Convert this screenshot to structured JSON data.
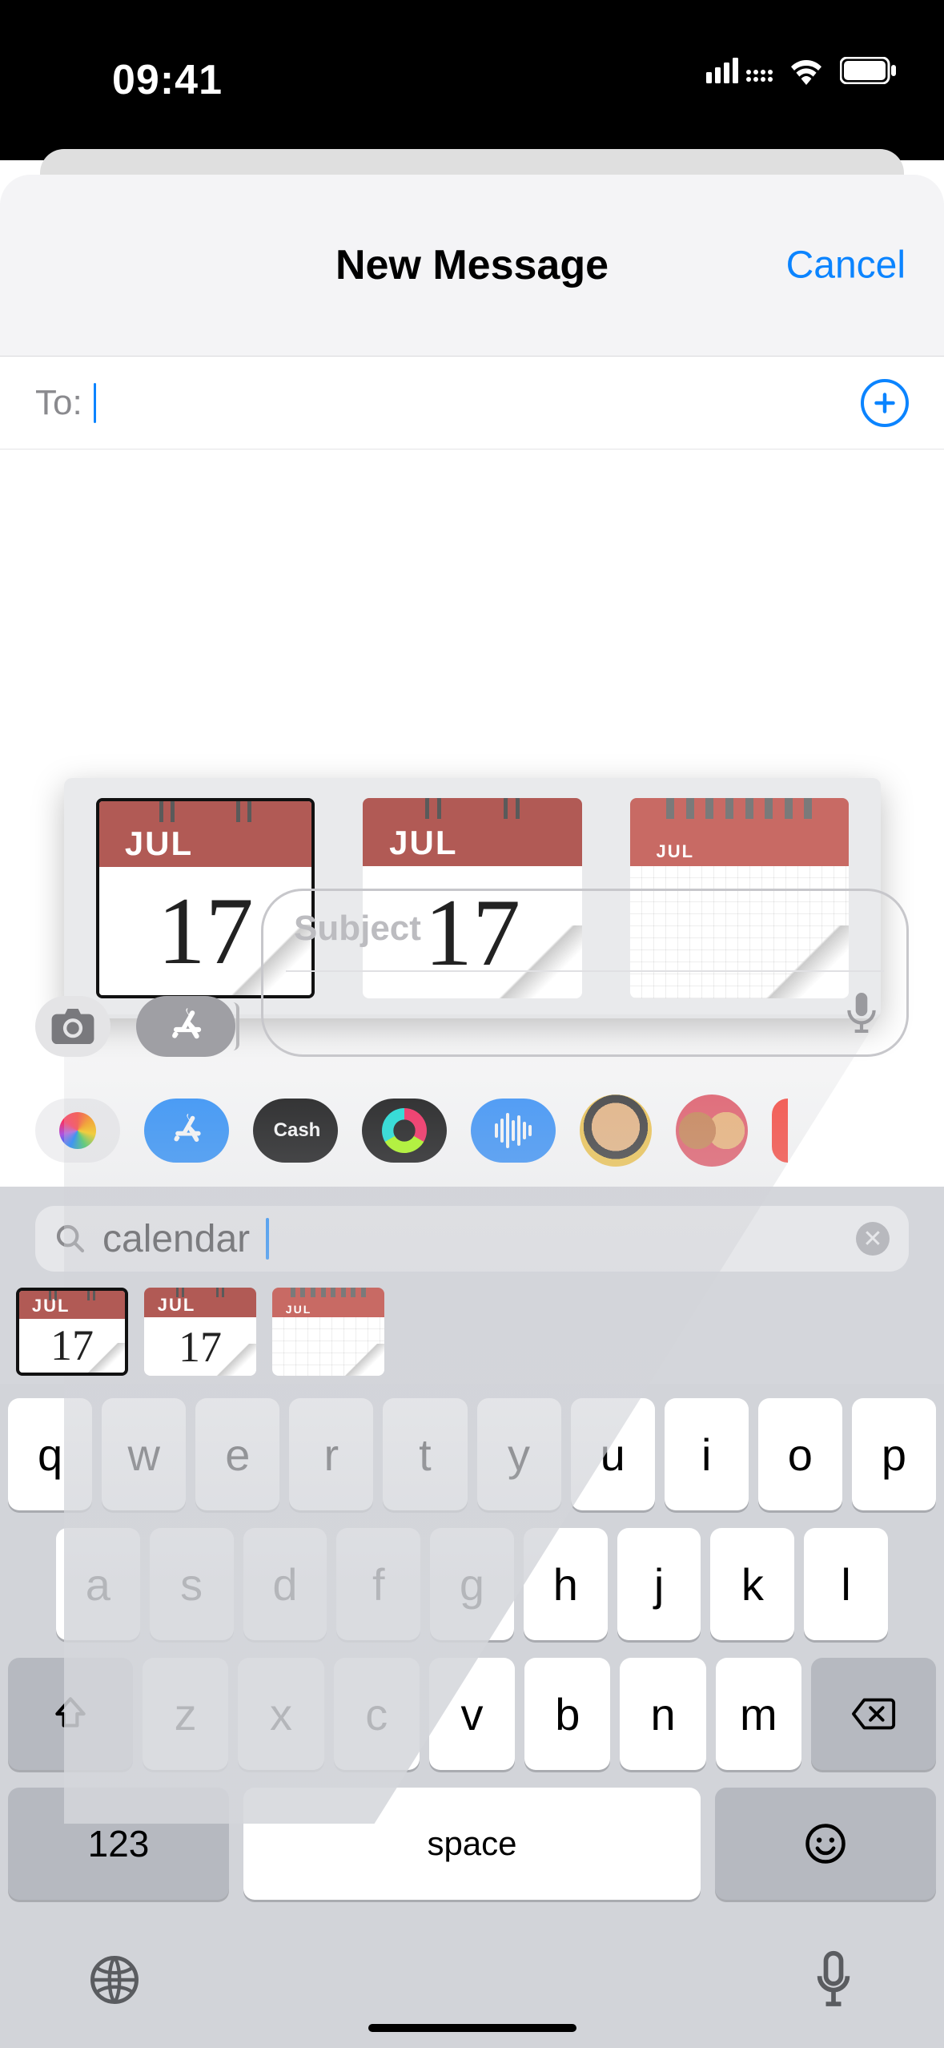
{
  "status": {
    "time": "09:41"
  },
  "sheet": {
    "title": "New Message",
    "cancel": "Cancel"
  },
  "compose": {
    "to_label": "To:",
    "to_value": "",
    "subject_placeholder": "Subject",
    "body_value": ""
  },
  "apps_strip": [
    {
      "name": "photos"
    },
    {
      "name": "app-store"
    },
    {
      "name": "apple-cash",
      "label": "Cash"
    },
    {
      "name": "fitness"
    },
    {
      "name": "audio-messages"
    },
    {
      "name": "memoji"
    },
    {
      "name": "memoji-stickers"
    }
  ],
  "emoji_search": {
    "query": "calendar",
    "results": [
      {
        "id": "calendar-emoji",
        "month": "JUL",
        "day": "17",
        "style": "bordered"
      },
      {
        "id": "tear-off-calendar-emoji",
        "month": "JUL",
        "day": "17",
        "style": "plain"
      },
      {
        "id": "spiral-calendar-emoji",
        "month": "JUL",
        "day": "",
        "style": "spiral-grid"
      }
    ]
  },
  "keyboard": {
    "row1": [
      "q",
      "w",
      "e",
      "r",
      "t",
      "y",
      "u",
      "i",
      "o",
      "p"
    ],
    "row2": [
      "a",
      "s",
      "d",
      "f",
      "g",
      "h",
      "j",
      "k",
      "l"
    ],
    "row3": [
      "z",
      "x",
      "c",
      "v",
      "b",
      "n",
      "m"
    ],
    "numbers_label": "123",
    "space_label": "space"
  }
}
